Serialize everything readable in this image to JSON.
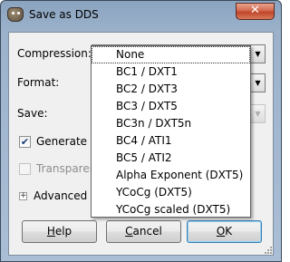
{
  "window": {
    "title": "Save as DDS",
    "close_glyph": "✕",
    "app_icon": "gimp-wilber-icon"
  },
  "compression": {
    "label": "Compression:",
    "value": "None"
  },
  "format": {
    "label": "Format:",
    "value": ""
  },
  "save": {
    "label": "Save:",
    "value": ""
  },
  "generate_mipmaps": {
    "label": "Generate m",
    "checked": true,
    "check_glyph": "✔"
  },
  "transparent": {
    "label": "Transparent",
    "checked": false,
    "enabled": false
  },
  "advanced": {
    "label": "Advanced O",
    "expander_glyph": "+"
  },
  "buttons": {
    "help": {
      "mnemonic": "H",
      "rest": "elp"
    },
    "cancel": {
      "mnemonic": "C",
      "rest": "ancel"
    },
    "ok": {
      "mnemonic": "O",
      "rest": "K"
    }
  },
  "dropdown": {
    "options": [
      "None",
      "BC1 / DXT1",
      "BC2 / DXT3",
      "BC3 / DXT5",
      "BC3n / DXT5n",
      "BC4 / ATI1",
      "BC5 / ATI2",
      "Alpha Exponent (DXT5)",
      "YCoCg (DXT5)",
      "YCoCg scaled (DXT5)"
    ],
    "selected_index": 0
  },
  "colors": {
    "titlebar": "#9cb2cb",
    "close_button": "#c0452a",
    "default_button_border": "#3c7fb1"
  }
}
